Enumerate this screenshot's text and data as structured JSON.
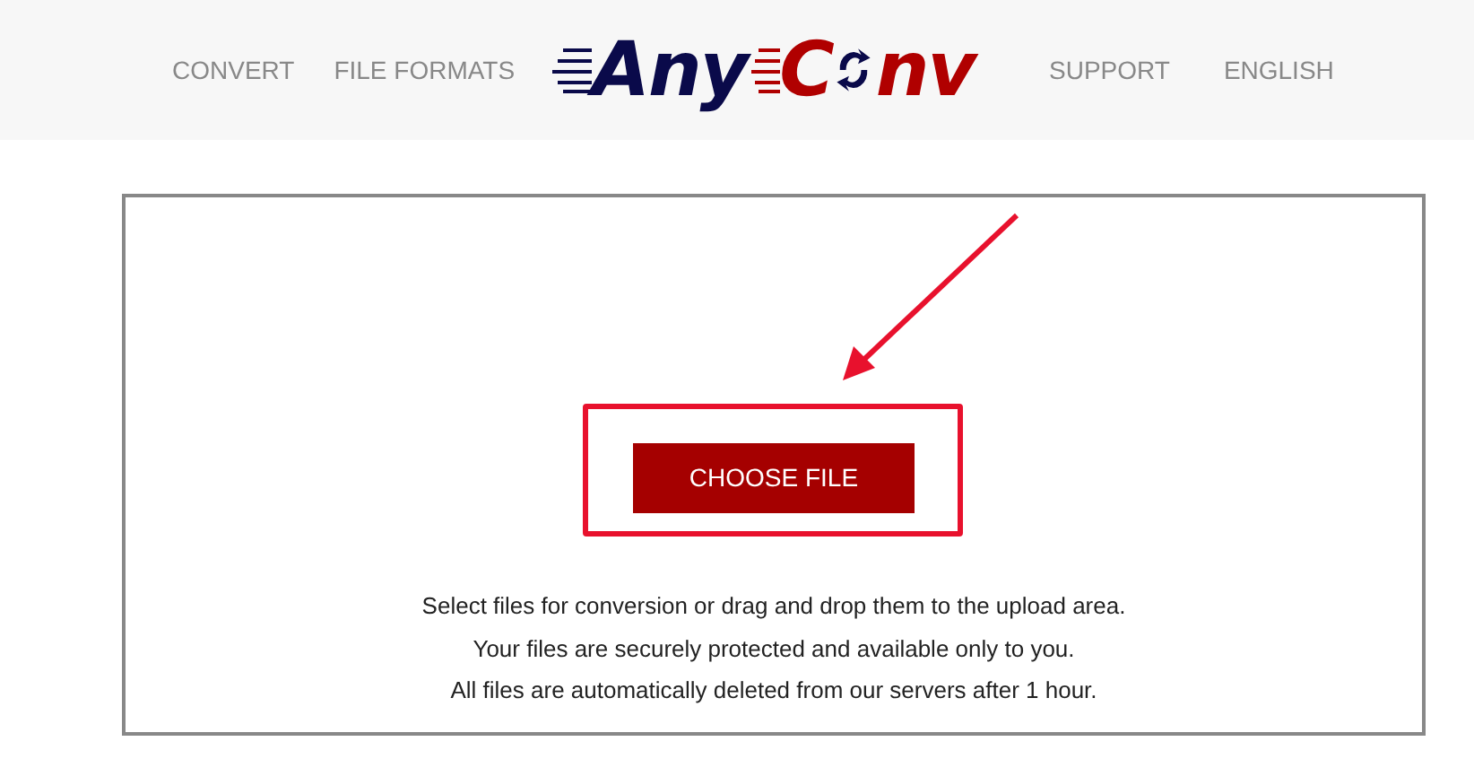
{
  "nav_left": [
    {
      "label": "CONVERT"
    },
    {
      "label": "FILE FORMATS"
    }
  ],
  "logo": {
    "part_1": "Any",
    "part_2": "C",
    "part_3": "nv"
  },
  "nav_right": [
    {
      "label": "SUPPORT"
    },
    {
      "label": "ENGLISH"
    }
  ],
  "upload": {
    "button": "CHOOSE FILE",
    "lines": [
      "Select files for conversion or drag and drop them to the upload area.",
      "Your files are securely protected and available only to you.",
      "All files are automatically deleted from our servers after 1 hour."
    ]
  }
}
